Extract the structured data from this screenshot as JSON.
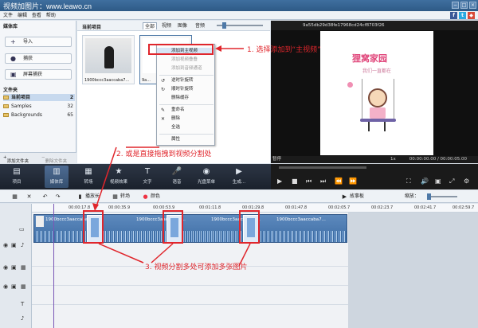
{
  "app": {
    "title": "视频加图片：www.leawo.cn",
    "window_buttons": [
      "−",
      "□",
      "×"
    ],
    "menu": [
      "文件",
      "编辑",
      "查看",
      "帮助"
    ],
    "social": [
      "f",
      "t",
      "◆"
    ]
  },
  "library": {
    "header": "媒体库",
    "buttons": [
      {
        "label": "导入",
        "icon": "+"
      },
      {
        "label": "捕获",
        "icon": "●"
      },
      {
        "label": "屏幕捕获",
        "icon": "▣"
      }
    ],
    "folders_header": "文件夹",
    "folders": [
      {
        "label": "当前项目",
        "count": "2"
      },
      {
        "label": "Samples",
        "count": "32"
      },
      {
        "label": "Backgrounds",
        "count": "65"
      }
    ],
    "add_folder": "添加文件夹",
    "delete_folder": "删除文件夹"
  },
  "project": {
    "header": "当前项目",
    "tabs": [
      "全部",
      "视频",
      "图像",
      "音频"
    ],
    "thumbs": [
      {
        "caption": "1900bccc3aaccaba7..."
      },
      {
        "caption": "9a..."
      }
    ]
  },
  "context_menu": {
    "items": [
      {
        "label": "添加到主视频",
        "icon": "",
        "disabled": false
      },
      {
        "label": "添加视频叠叠",
        "icon": "",
        "disabled": true
      },
      {
        "label": "添加到音频通道",
        "icon": "",
        "disabled": true
      },
      {
        "label": "逆时针旋转",
        "icon": "↺",
        "disabled": false
      },
      {
        "label": "顺时针旋转",
        "icon": "↻",
        "disabled": false
      },
      {
        "label": "删除缓存",
        "icon": "",
        "disabled": false
      },
      {
        "label": "重命名",
        "icon": "✎",
        "disabled": false
      },
      {
        "label": "删除",
        "icon": "✕",
        "disabled": false
      },
      {
        "label": "全选",
        "icon": "",
        "disabled": false
      },
      {
        "label": "属性",
        "icon": "",
        "disabled": false
      }
    ]
  },
  "preview": {
    "filename": "9a55db29d38fe17968cd24cf8703f26",
    "title_text": "狸窝家园",
    "sub_text": "我们一直都在",
    "status": "暂停",
    "speed": "1x",
    "time": "00:00:00.00 / 00:00:05.00"
  },
  "toolbar": {
    "tools": [
      {
        "label": "项目",
        "icon": "▤"
      },
      {
        "label": "媒体库",
        "icon": "▥"
      },
      {
        "label": "转场",
        "icon": "▦"
      },
      {
        "label": "视频效果",
        "icon": "★"
      },
      {
        "label": "文字",
        "icon": "T"
      },
      {
        "label": "语音",
        "icon": "🎤"
      },
      {
        "label": "光盘菜单",
        "icon": "◉"
      },
      {
        "label": "生成...",
        "icon": "▶"
      }
    ]
  },
  "player": {
    "buttons": [
      "▶",
      "■",
      "⏮",
      "⏭",
      "⏪",
      "⏩",
      "⛶",
      "🔊",
      "▣",
      "⤢",
      "⚙"
    ]
  },
  "timeline_tools": {
    "items": [
      {
        "label": "",
        "icon": "▦"
      },
      {
        "label": "",
        "icon": "✕"
      },
      {
        "label": "",
        "icon": "↶"
      },
      {
        "label": "",
        "icon": "↷"
      },
      {
        "label": "播放长",
        "icon": "▮"
      },
      {
        "label": "转场",
        "icon": "▦"
      },
      {
        "label": "颜色",
        "icon": "●"
      }
    ],
    "storyboard": "故事板",
    "zoom_label": "缩放："
  },
  "timeline": {
    "ruler": [
      "00:00:17.8",
      "00:00:35.9",
      "00:00:53.9",
      "00:01:11.8",
      "00:01:29.8",
      "00:01:47.8",
      "00:02:05.7",
      "00:02:23.7",
      "00:02:41.7",
      "00:02:59.7"
    ],
    "clip_name": "1900bccc3aaccaba7..."
  },
  "annotations": {
    "a1": "1. 选择添加到“主视频”",
    "a2": "2. 或是直接拖拽到视频分割处",
    "a3": "3. 视频分割多处可添加多张图片"
  },
  "colors": {
    "annotation_red": "#e0262c",
    "title_bar": "#2e5a86",
    "toolbar_dark": "#1a212c",
    "clip_blue": "#3e6ea5"
  }
}
